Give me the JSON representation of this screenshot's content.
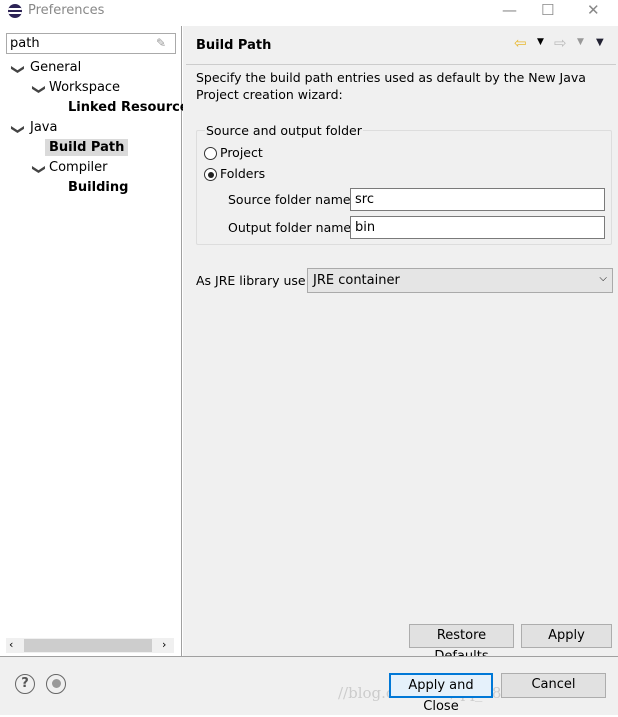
{
  "window": {
    "title": "Preferences",
    "minimize": "—",
    "maximize": "☐",
    "close": "✕"
  },
  "filter": {
    "value": "path"
  },
  "tree": [
    {
      "label": "General",
      "expanded": true
    },
    {
      "label": "Workspace",
      "expanded": true
    },
    {
      "label": "Linked Resources"
    },
    {
      "label": "Java",
      "expanded": true
    },
    {
      "label": "Build Path",
      "selected": true
    },
    {
      "label": "Compiler",
      "expanded": true
    },
    {
      "label": "Building"
    }
  ],
  "page": {
    "title": "Build Path",
    "description": "Specify the build path entries used as default by the New Java Project creation wizard:",
    "group_title": "Source and output folder",
    "radio_project": "Project",
    "radio_folders": "Folders",
    "selected_radio": "Folders",
    "source_label": "Source folder name:",
    "source_value": "src",
    "output_label": "Output folder name:",
    "output_value": "bin",
    "jre_label": "As JRE library use:",
    "jre_value": "JRE container",
    "restore_defaults": "Restore Defaults",
    "apply": "Apply"
  },
  "footer": {
    "apply_close": "Apply and Close",
    "cancel": "Cancel",
    "help": "?"
  },
  "watermark": "//blog.csdn.net/qq_38409941",
  "colors": {
    "accent_focus": "#0078d7",
    "back_arrow": "#e8b830"
  }
}
